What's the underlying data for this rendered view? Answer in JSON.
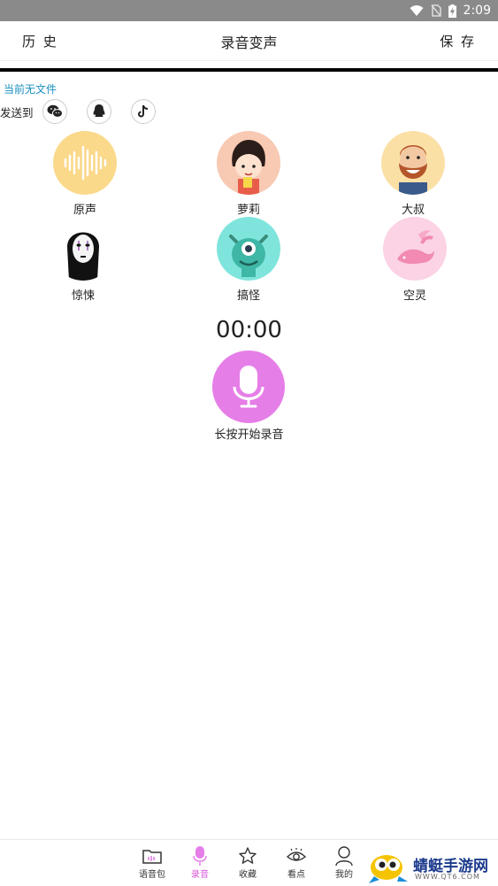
{
  "status_bar": {
    "time": "2:09"
  },
  "header": {
    "left_label": "历 史",
    "title": "录音变声",
    "right_label": "保 存"
  },
  "file_status": "当前无文件",
  "send_to": {
    "label": "发送到",
    "targets": [
      "wechat-icon",
      "qq-icon",
      "tiktok-icon"
    ]
  },
  "voices": [
    {
      "name": "原声",
      "icon": "waveform-icon",
      "color": "#fbd98a"
    },
    {
      "name": "萝莉",
      "icon": "girl-avatar-icon",
      "color": "#f8c9b3"
    },
    {
      "name": "大叔",
      "icon": "bearded-man-avatar-icon",
      "color": "#fbe0a6"
    },
    {
      "name": "惊悚",
      "icon": "no-face-ghost-icon",
      "color": "#ffffff"
    },
    {
      "name": "搞怪",
      "icon": "monster-avatar-icon",
      "color": "#7fe5dc"
    },
    {
      "name": "空灵",
      "icon": "pink-dolphin-icon",
      "color": "#fbd3e5"
    }
  ],
  "timer": "00:00",
  "record_hint": "长按开始录音",
  "accent_color": "#e67ee8",
  "tabs": [
    {
      "label": "语音包",
      "icon": "folder-voice-icon"
    },
    {
      "label": "录音",
      "icon": "microphone-icon",
      "active": true
    },
    {
      "label": "收藏",
      "icon": "star-icon"
    },
    {
      "label": "看点",
      "icon": "eye-icon"
    },
    {
      "label": "我的",
      "icon": "person-icon"
    }
  ],
  "watermark": {
    "title": "蜻蜓手游网",
    "url": "WWW.QT6.COM"
  }
}
